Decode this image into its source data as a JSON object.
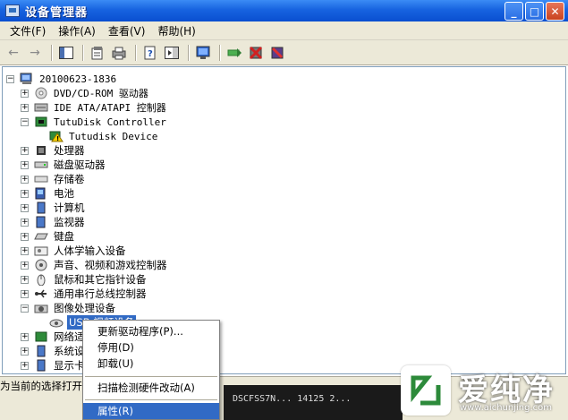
{
  "window": {
    "title": "设备管理器",
    "controls": {
      "minimize": "_",
      "maximize": "□",
      "close": "✕"
    }
  },
  "menubar": {
    "items": [
      {
        "label": "文件(F)"
      },
      {
        "label": "操作(A)"
      },
      {
        "label": "查看(V)"
      },
      {
        "label": "帮助(H)"
      }
    ]
  },
  "toolbar": {
    "back": "←",
    "forward": "→"
  },
  "tree": {
    "root": "20100623-1836",
    "items": [
      {
        "label": "DVD/CD-ROM 驱动器",
        "expander": "+"
      },
      {
        "label": "IDE ATA/ATAPI 控制器",
        "expander": "+"
      },
      {
        "label": "TutuDisk Controller",
        "expander": "−"
      },
      {
        "label": "Tutudisk Device",
        "child": true
      },
      {
        "label": "处理器",
        "expander": "+"
      },
      {
        "label": "磁盘驱动器",
        "expander": "+"
      },
      {
        "label": "存储卷",
        "expander": "+"
      },
      {
        "label": "电池",
        "expander": "+"
      },
      {
        "label": "计算机",
        "expander": "+"
      },
      {
        "label": "监视器",
        "expander": "+"
      },
      {
        "label": "键盘",
        "expander": "+"
      },
      {
        "label": "人体学输入设备",
        "expander": "+"
      },
      {
        "label": "声音、视频和游戏控制器",
        "expander": "+"
      },
      {
        "label": "鼠标和其它指针设备",
        "expander": "+"
      },
      {
        "label": "通用串行总线控制器",
        "expander": "+"
      },
      {
        "label": "图像处理设备",
        "expander": "−"
      },
      {
        "label": "USB 视频设备",
        "child": true,
        "selected": true
      },
      {
        "label": "网络适",
        "expander": "+"
      },
      {
        "label": "系统设",
        "expander": "+"
      },
      {
        "label": "显示卡",
        "expander": "+"
      }
    ]
  },
  "context_menu": {
    "items": [
      {
        "label": "更新驱动程序(P)..."
      },
      {
        "label": "停用(D)"
      },
      {
        "label": "卸载(U)"
      },
      {
        "label": "扫描检测硬件改动(A)"
      },
      {
        "label": "属性(R)",
        "selected": true
      }
    ]
  },
  "statusbar": {
    "text": "为当前的选择打开"
  },
  "background_text": "DSCFSS7N... 14125 2...",
  "watermark": {
    "text": "爱纯净",
    "url": "www.aichunjing.com"
  },
  "colors": {
    "titlebar": "#0a4fd0",
    "selection": "#316ac5",
    "chrome": "#ece9d8"
  }
}
